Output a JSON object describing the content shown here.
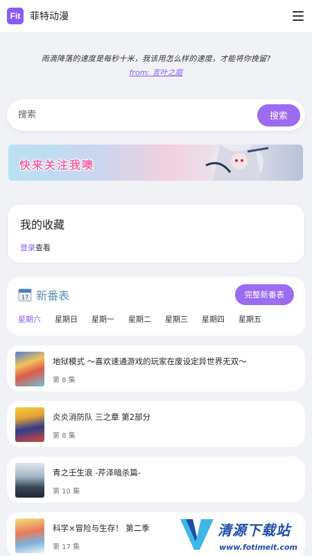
{
  "app": {
    "logo_text": "Fit",
    "title": "菲特动漫"
  },
  "quote": {
    "text": "雨滴降落的速度是每秒十米，我该用怎么样的速度，才能将你挽留?",
    "from": "from: 言叶之庭"
  },
  "search": {
    "placeholder": "搜索",
    "button_label": "搜索"
  },
  "banner": {
    "text": "快来关注我噢"
  },
  "favorites": {
    "title": "我的收藏",
    "login_link": "登录",
    "login_suffix": "查看"
  },
  "schedule": {
    "title": "新番表",
    "calendar_day": "17",
    "full_button": "完整新番表",
    "days": [
      "星期六",
      "星期日",
      "星期一",
      "星期二",
      "星期三",
      "星期四",
      "星期五"
    ],
    "active_day": "星期六"
  },
  "anime": [
    {
      "title": "地狱模式 ～喜欢速通游戏的玩家在废设定异世界无双～",
      "episode": "第 8 集"
    },
    {
      "title": "炎炎消防队 三之章 第2部分",
      "episode": "第 8 集"
    },
    {
      "title": "青之壬生浪 -芹泽暗杀篇-",
      "episode": "第 10 集"
    },
    {
      "title": "科学×冒险与生存！ 第二季",
      "episode": "第 17 集"
    }
  ],
  "watermark": {
    "title": "清源下载站",
    "url": "www.fotimeit.com"
  },
  "colors": {
    "accent": "#9b6bf0",
    "schedule_title": "#5d8fb5",
    "background": "#f1f2f6"
  }
}
